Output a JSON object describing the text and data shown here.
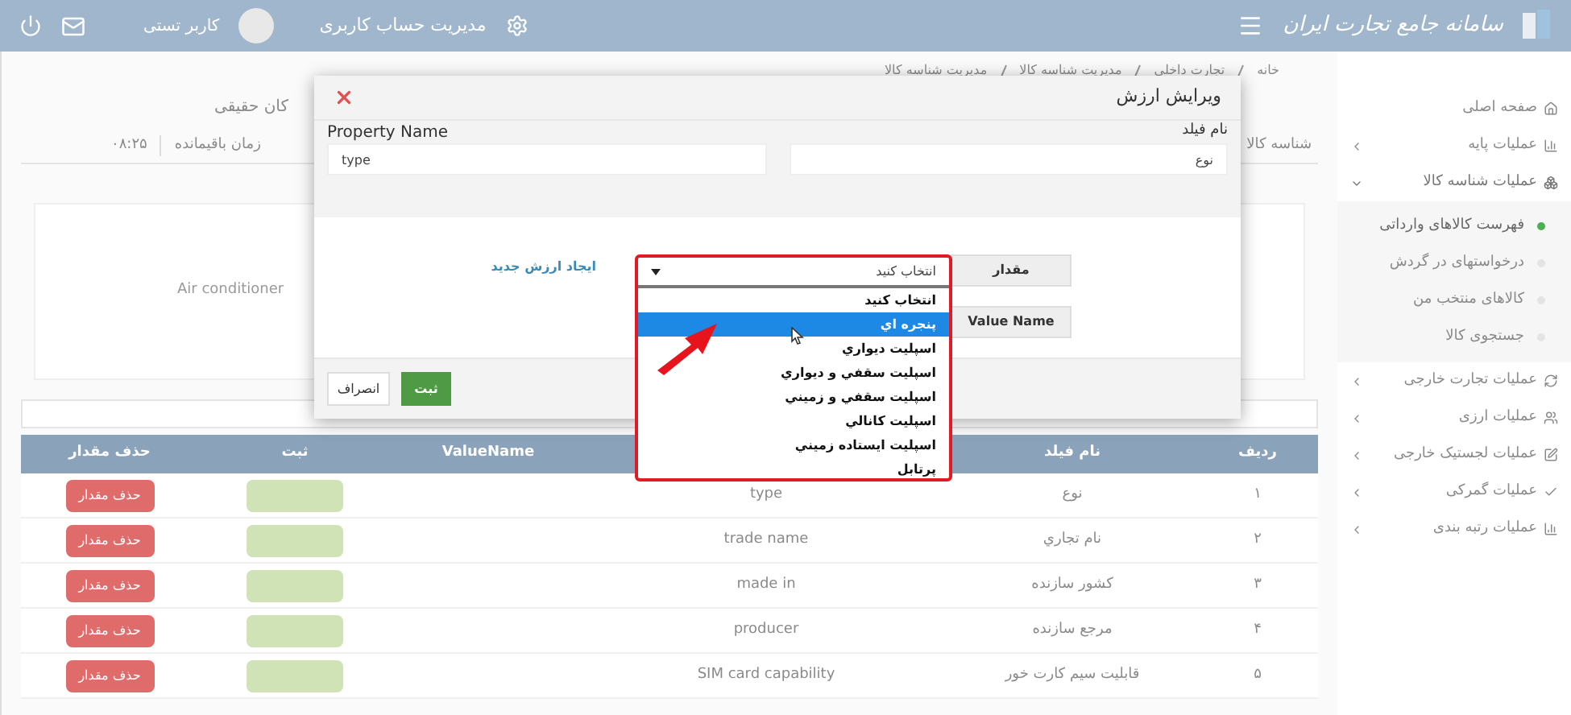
{
  "header": {
    "logo_text": "سامانه جامع تجارت ایران",
    "account_link": "مدیریت حساب کاربری",
    "user_name": "کاربر تستی"
  },
  "breadcrumb": [
    "خانه",
    "تجارت داخلی",
    "مدیریت شناسه کالا",
    "مدیریت شناسه کالا"
  ],
  "page_title": "کان حقیقی",
  "info_bar": {
    "tab": "شناسه کالا",
    "remaining_label": "زمان باقیمانده",
    "remaining_value": "۰۸:۲۵"
  },
  "product_card": {
    "name": "Air conditioner"
  },
  "sidebar": {
    "items": [
      {
        "label": "صفحه اصلی",
        "kind": "link"
      },
      {
        "label": "عملیات پایه",
        "kind": "group",
        "expanded": false
      },
      {
        "label": "عملیات شناسه کالا",
        "kind": "group",
        "expanded": true,
        "children": [
          {
            "label": "فهرست کالاهای وارداتی",
            "selected": true
          },
          {
            "label": "درخواستهای در گردش",
            "selected": false
          },
          {
            "label": "کالاهای منتخب من",
            "selected": false
          },
          {
            "label": "جستجوی کالا",
            "selected": false
          }
        ]
      },
      {
        "label": "عملیات تجارت خارجی",
        "kind": "group",
        "expanded": false
      },
      {
        "label": "عملیات ارزی",
        "kind": "group",
        "expanded": false
      },
      {
        "label": "عملیات لجستیک خارجی",
        "kind": "group",
        "expanded": false
      },
      {
        "label": "عملیات گمرکی",
        "kind": "group",
        "expanded": false
      },
      {
        "label": "عملیات رتبه بندی",
        "kind": "group",
        "expanded": false
      }
    ]
  },
  "table": {
    "columns": [
      "ردیف",
      "نام فیلد",
      "",
      "ValueName",
      "ثبت",
      "حذف مقدار"
    ],
    "rows": [
      {
        "index": "۱",
        "field": "نوع",
        "property": "type",
        "delete": "حذف مقدار"
      },
      {
        "index": "۲",
        "field": "نام تجاري",
        "property": "trade name",
        "delete": "حذف مقدار"
      },
      {
        "index": "۳",
        "field": "کشور سازنده",
        "property": "made in",
        "delete": "حذف مقدار"
      },
      {
        "index": "۴",
        "field": "مرجع سازنده",
        "property": "producer",
        "delete": "حذف مقدار"
      },
      {
        "index": "۵",
        "field": "قابلیت سیم کارت خور",
        "property": "SIM card capability",
        "delete": "حذف مقدار"
      }
    ]
  },
  "dialog": {
    "title": "ویرایش ارزش",
    "field_label": "نام فیلد",
    "field_value": "نوع",
    "property_label": "Property Name",
    "property_value": "type",
    "value_button": "مقدار",
    "value_name_button": "Value Name",
    "new_value_link": "ایجاد ارزش جدید",
    "select": {
      "value": "انتخاب کنید",
      "expanded": true,
      "options": [
        {
          "label": "انتخاب کنید",
          "highlighted": false
        },
        {
          "label": "پنجره اي",
          "highlighted": true
        },
        {
          "label": "اسپلیت دیواري",
          "highlighted": false
        },
        {
          "label": "اسپلیت سقفي و دیواري",
          "highlighted": false
        },
        {
          "label": "اسپلیت سقفي و زمیني",
          "highlighted": false
        },
        {
          "label": "اسپلیت کانالي",
          "highlighted": false
        },
        {
          "label": "اسپلیت ایستاده زمیني",
          "highlighted": false
        },
        {
          "label": "پرتابل",
          "highlighted": false
        }
      ]
    },
    "save_button": "ثبت",
    "cancel_button": "انصراف"
  }
}
